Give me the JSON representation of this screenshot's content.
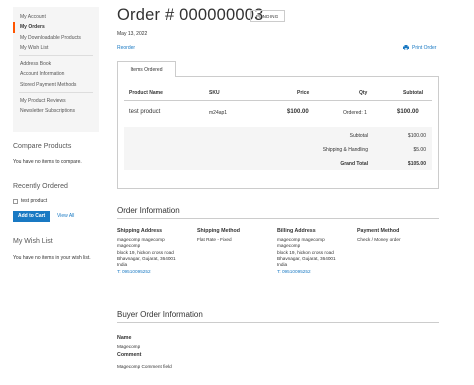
{
  "sidebar": {
    "items": [
      {
        "label": "My Account",
        "current": false
      },
      {
        "label": "My Orders",
        "current": true
      },
      {
        "label": "My Downloadable Products",
        "current": false
      },
      {
        "label": "My Wish List",
        "current": false
      },
      {
        "label": "Address Book",
        "current": false
      },
      {
        "label": "Account Information",
        "current": false
      },
      {
        "label": "Stored Payment Methods",
        "current": false
      },
      {
        "label": "My Product Reviews",
        "current": false
      },
      {
        "label": "Newsletter Subscriptions",
        "current": false
      }
    ],
    "accent_color": "#ff5501"
  },
  "compare": {
    "title": "Compare Products",
    "empty_text": "You have no items to compare."
  },
  "recently_ordered": {
    "title": "Recently Ordered",
    "item_label": "test product",
    "add_to_cart_label": "Add to Cart",
    "view_all_label": "View All"
  },
  "wishlist": {
    "title": "My Wish List",
    "empty_text": "You have no items in your wish list."
  },
  "order": {
    "title": "Order # 000000003",
    "status": "PENDING",
    "date": "May 13, 2022",
    "reorder_label": "Reorder",
    "print_label": "Print Order",
    "tab_label": "Items Ordered",
    "table": {
      "headers": [
        "Product Name",
        "SKU",
        "Price",
        "Qty",
        "Subtotal"
      ],
      "rows": [
        {
          "name": "test product",
          "sku": "m24ap1",
          "price": "$100.00",
          "qty": "Ordered: 1",
          "subtotal": "$100.00"
        }
      ]
    },
    "totals": [
      {
        "label": "Subtotal",
        "value": "$100.00",
        "bold": false
      },
      {
        "label": "Shipping & Handling",
        "value": "$5.00",
        "bold": false
      },
      {
        "label": "Grand Total",
        "value": "$105.00",
        "bold": true
      }
    ]
  },
  "order_info": {
    "title": "Order Information",
    "shipping_address": {
      "title": "Shipping Address",
      "lines": [
        "magecomp magecomp",
        "magecomp",
        "block 19, hickon cross road",
        "Bhavnagar, Gujarat, 364001",
        "India"
      ],
      "phone": "T: 09510095252"
    },
    "shipping_method": {
      "title": "Shipping Method",
      "value": "Flat Rate - Fixed"
    },
    "billing_address": {
      "title": "Billing Address",
      "lines": [
        "magecomp magecomp",
        "magecomp",
        "block 19, hickon cross road",
        "Bhavnagar, Gujarat, 364001",
        "India"
      ],
      "phone": "T: 09510095252"
    },
    "payment_method": {
      "title": "Payment Method",
      "value": "Check / Money order"
    }
  },
  "buyer_info": {
    "title": "Buyer Order Information",
    "name_label": "Name",
    "name_value": "Magecomp",
    "comment_label": "Comment",
    "comment_value": "Magecomp Comment field"
  },
  "colors": {
    "link": "#1979c3",
    "button": "#1979c3",
    "nav_bg": "#f5f5f5"
  }
}
